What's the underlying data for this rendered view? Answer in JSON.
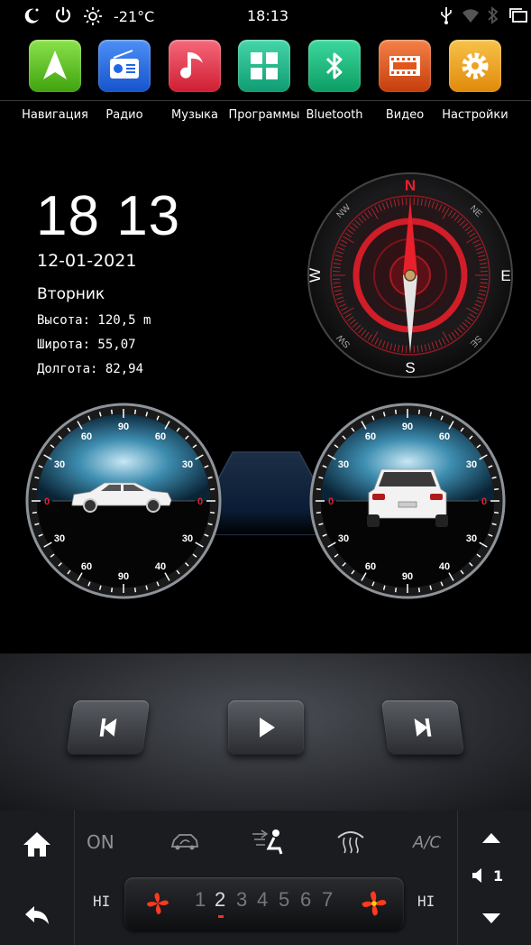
{
  "status_bar": {
    "temperature": "-21°C",
    "time": "18:13",
    "icons": [
      "night-mode-icon",
      "power-icon",
      "brightness-icon",
      "usb-icon",
      "wifi-icon",
      "bluetooth-icon",
      "recent-apps-icon"
    ]
  },
  "apps": [
    {
      "label": "Навигация",
      "icon": "navigation-icon",
      "color": "#59c316"
    },
    {
      "label": "Радио",
      "icon": "radio-icon",
      "color": "#1f67e6"
    },
    {
      "label": "Музыка",
      "icon": "music-icon",
      "color": "#e83a4c"
    },
    {
      "label": "Программы",
      "icon": "apps-grid-icon",
      "color": "#1fb88b"
    },
    {
      "label": "Bluetooth",
      "icon": "bluetooth-icon",
      "color": "#19b97a"
    },
    {
      "label": "Видео",
      "icon": "film-icon",
      "color": "#e2561c"
    },
    {
      "label": "Настройки",
      "icon": "gear-icon",
      "color": "#f0a21c"
    }
  ],
  "clock": {
    "time": "18 13",
    "date": "12-01-2021",
    "weekday": "Вторник"
  },
  "gps": {
    "altitude": "Высота: 120,5 m",
    "latitude": "Широта: 55,07",
    "longitude": "Долгота: 82,94"
  },
  "compass": {
    "heading_deg": 0,
    "labels": {
      "n": "N",
      "s": "S",
      "e": "E",
      "w": "W",
      "ne": "NE",
      "nw": "NW",
      "se": "SE",
      "sw": "SW"
    }
  },
  "inclinometers": {
    "pitch": {
      "tick_labels": {
        "top": "90",
        "upper": "60",
        "mid_upper": "30",
        "zero": "0",
        "lower": "30",
        "bottom_left": "60",
        "bottom_right": "40",
        "bottom": "90"
      },
      "value_deg": 0
    },
    "roll": {
      "tick_labels": {
        "top": "90",
        "upper": "60",
        "mid_upper": "30",
        "zero": "0",
        "lower": "30",
        "bottom_left": "60",
        "bottom_right": "40",
        "bottom": "90"
      },
      "value_deg": 0
    }
  },
  "media": {
    "buttons": [
      "prev-icon",
      "play-icon",
      "next-icon"
    ]
  },
  "climate": {
    "on_label": "ON",
    "ac_label": "A/C",
    "hi_left": "HI",
    "hi_right": "HI",
    "fan_levels": [
      "1",
      "2",
      "3",
      "4",
      "5",
      "6",
      "7"
    ],
    "fan_current": "2",
    "volume_value": "1"
  }
}
